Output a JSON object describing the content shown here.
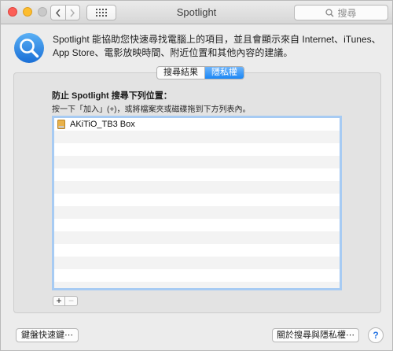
{
  "window": {
    "title": "Spotlight",
    "search_placeholder": "搜尋"
  },
  "header": {
    "description": "Spotlight 能協助您快速尋找電腦上的項目，並且會顯示來自 Internet、iTunes、App Store、電影放映時間、附近位置和其他內容的建議。"
  },
  "tabs": [
    {
      "label": "搜尋結果",
      "active": false
    },
    {
      "label": "隱私權",
      "active": true
    }
  ],
  "privacy": {
    "title": "防止 Spotlight 搜尋下列位置：",
    "hint": "按一下「加入」(+)，或將檔案夾或磁碟拖到下方列表內。",
    "items": [
      {
        "label": "AKiTiO_TB3 Box",
        "icon": "external-disk-icon"
      }
    ],
    "add_label": "+",
    "remove_label": "−"
  },
  "footer": {
    "keyboard_shortcuts": "鍵盤快速鍵⋯",
    "about": "關於搜尋與隱私權⋯",
    "help": "?"
  },
  "colors": {
    "accent": "#1b86f5",
    "list_focus_ring": "#a7cbf3",
    "close": "#fc5f57",
    "minimize": "#fdbd2e"
  }
}
